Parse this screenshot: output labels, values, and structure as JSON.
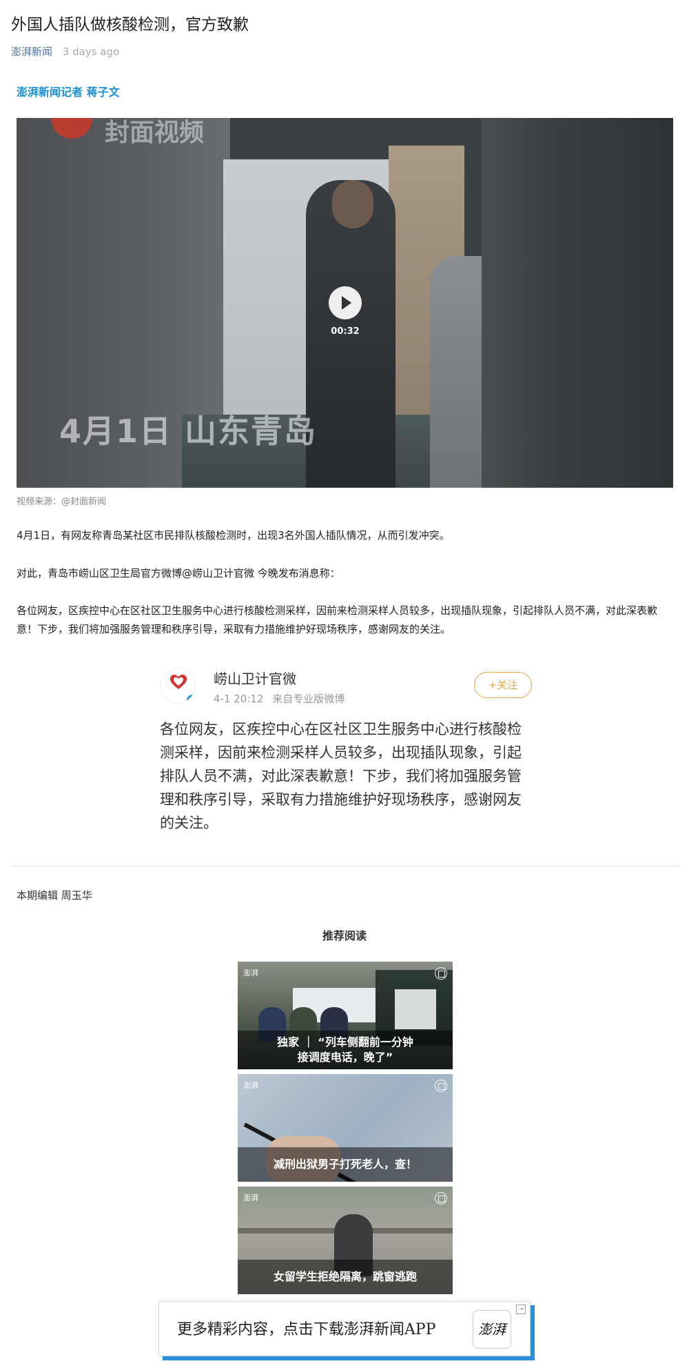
{
  "article": {
    "title": "外国人插队做核酸检测，官方致歉",
    "source": "澎湃新闻",
    "time": "3 days ago",
    "reporter": "澎湃新闻记者 蒋子文"
  },
  "video": {
    "watermark": "封面视频",
    "caption": "4月1日  山东青岛",
    "duration": "00:32",
    "source_note": "视频来源：@封面新闻"
  },
  "body": {
    "p1": "4月1日，有网友称青岛某社区市民排队核酸检测时，出现3名外国人插队情况，从而引发冲突。",
    "p2": "对此，青岛市崂山区卫生局官方微博@崂山卫计官微 今晚发布消息称：",
    "p3": "各位网友，区疾控中心在区社区卫生服务中心进行核酸检测采样，因前来检测采样人员较多，出现插队现象，引起排队人员不满，对此深表歉意！下步，我们将加强服务管理和秩序引导，采取有力措施维护好现场秩序，感谢网友的关注。"
  },
  "weibo": {
    "name": "崂山卫计官微",
    "date": "4-1 20:12",
    "via": "来自专业版微博",
    "follow_label": "+关注",
    "text": "各位网友，区疾控中心在区社区卫生服务中心进行核酸检测采样，因前来检测采样人员较多，出现插队现象，引起排队人员不满，对此深表歉意！下步，我们将加强服务管理和秩序引导，采取有力措施维护好现场秩序，感谢网友的关注。",
    "verified_icon": "verified-badge-icon"
  },
  "editor": "本期编辑 周玉华",
  "recommend": {
    "title": "推荐阅读",
    "items": [
      {
        "title_line1": "独家 ｜ “列车侧翻前一分钟",
        "title_line2": "接调度电话，晚了”",
        "brand": "澎湃"
      },
      {
        "title_line1": "减刑出狱男子打死老人，查！",
        "title_line2": "",
        "brand": "澎湃"
      },
      {
        "title_line1": "女留学生拒绝隔离，跳窗逃跑",
        "title_line2": "",
        "brand": "澎湃"
      }
    ]
  },
  "app_banner": {
    "text": "更多精彩内容，点击下载澎湃新闻APP",
    "logo_text": "澎湃"
  },
  "colors": {
    "accent_blue": "#1a8fd5",
    "source_blue": "#4a6fa0",
    "follow_orange": "#e8a447",
    "banner_shadow": "#2a8fd8"
  }
}
